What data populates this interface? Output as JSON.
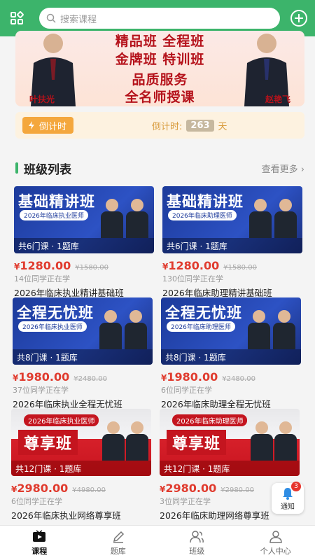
{
  "search": {
    "placeholder": "搜索课程"
  },
  "banner": {
    "lines": [
      "精品班 全程班",
      "金牌班 特训班",
      "品质服务",
      "全名师授课"
    ],
    "teacher_left": "叶扶光",
    "teacher_right": "赵艳飞"
  },
  "countdown": {
    "tag": "倒计时",
    "label": "倒计时:",
    "days": "263",
    "unit": "天"
  },
  "section": {
    "title": "班级列表",
    "more": "查看更多 ›"
  },
  "courses": [
    {
      "theme": "blue",
      "banner_title": "基础精讲班",
      "banner_band": "2026年临床执业医师",
      "banner_footer": "共6门课 · 1题库",
      "price": "1280.00",
      "original_price": "¥1580.00",
      "students": "14位同学正在学",
      "title": "2026年临床执业精讲基础班"
    },
    {
      "theme": "blue",
      "banner_title": "基础精讲班",
      "banner_band": "2026年临床助理医师",
      "banner_footer": "共6门课 · 1题库",
      "price": "1280.00",
      "original_price": "¥1580.00",
      "students": "130位同学正在学",
      "title": "2026年临床助理精讲基础班"
    },
    {
      "theme": "blue",
      "banner_title": "全程无忧班",
      "banner_band": "2026年临床执业医师",
      "banner_footer": "共8门课 · 1题库",
      "price": "1980.00",
      "original_price": "¥2480.00",
      "students": "37位同学正在学",
      "title": "2026年临床执业全程无忧班"
    },
    {
      "theme": "blue",
      "banner_title": "全程无忧班",
      "banner_band": "2026年临床助理医师",
      "banner_footer": "共8门课 · 1题库",
      "price": "1980.00",
      "original_price": "¥2480.00",
      "students": "6位同学正在学",
      "title": "2026年临床助理全程无忧班"
    },
    {
      "theme": "red",
      "banner_title": "尊享班",
      "banner_band": "2026年临床执业医师",
      "banner_footer": "共12门课 · 1题库",
      "price": "2980.00",
      "original_price": "¥4980.00",
      "students": "6位同学正在学",
      "title": "2026年临床执业网络尊享班"
    },
    {
      "theme": "red",
      "banner_title": "尊享班",
      "banner_band": "2026年临床助理医师",
      "banner_footer": "共12门课 · 1题库",
      "price": "2980.00",
      "original_price": "¥2980.00",
      "students": "3位同学正在学",
      "title": "2026年临床助理网络尊享班"
    }
  ],
  "notify": {
    "label": "通知",
    "count": "3"
  },
  "tabs": [
    {
      "label": "课程",
      "icon": "play-icon"
    },
    {
      "label": "题库",
      "icon": "pencil-icon"
    },
    {
      "label": "班级",
      "icon": "group-icon"
    },
    {
      "label": "个人中心",
      "icon": "person-icon"
    }
  ],
  "colors": {
    "brand_green": "#3cb46b",
    "price_red": "#e03b2e"
  }
}
